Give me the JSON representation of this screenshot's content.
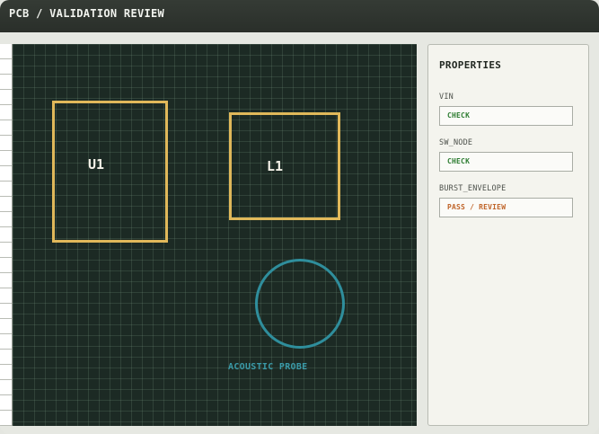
{
  "title": "PCB / VALIDATION REVIEW",
  "canvas": {
    "components": [
      {
        "ref": "U1"
      },
      {
        "ref": "L1"
      }
    ],
    "probe_label": "ACOUSTIC PROBE"
  },
  "colors": {
    "component_outline": "#e0b85a",
    "probe": "#2f8e9c",
    "board": "#1c2a24",
    "status_check": "#2e7d32",
    "status_review": "#c0652a"
  },
  "properties": {
    "title": "PROPERTIES",
    "items": [
      {
        "label": "VIN",
        "value": "CHECK",
        "status": "check"
      },
      {
        "label": "SW_NODE",
        "value": "CHECK",
        "status": "check"
      },
      {
        "label": "BURST_ENVELOPE",
        "value": "PASS / REVIEW",
        "status": "review"
      }
    ]
  }
}
